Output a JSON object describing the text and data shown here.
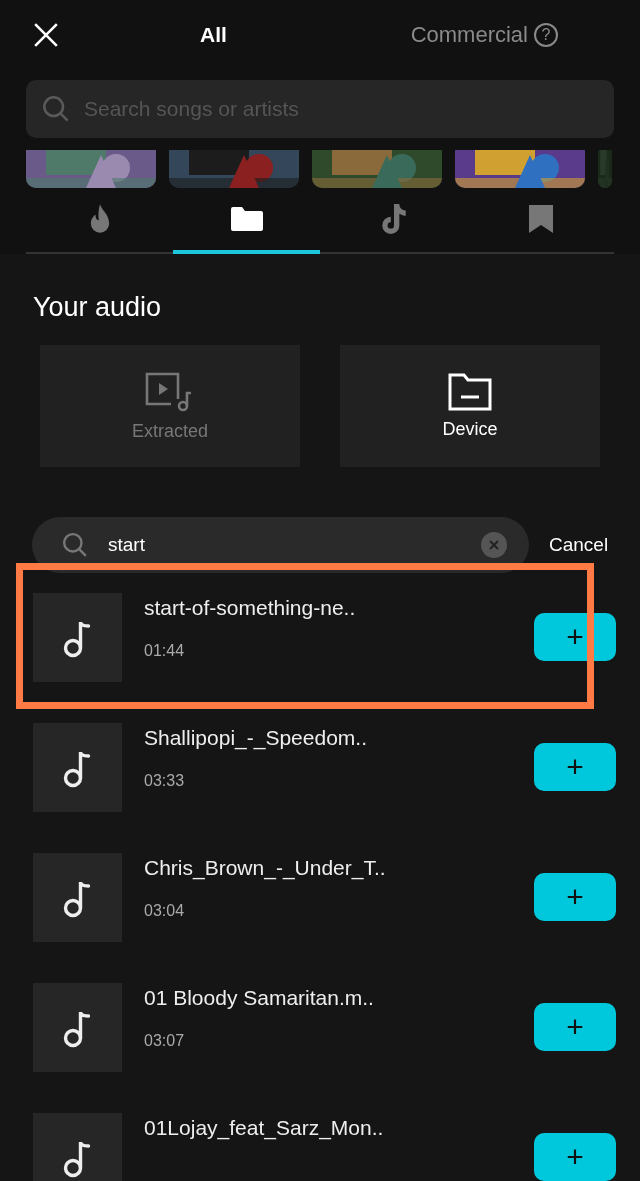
{
  "header": {
    "title": "All",
    "commercial": "Commercial",
    "help_icon_text": "?"
  },
  "search": {
    "placeholder": "Search songs or artists"
  },
  "tabs": [
    {
      "selected": false
    },
    {
      "selected": true
    },
    {
      "selected": false
    },
    {
      "selected": false
    }
  ],
  "section_title": "Your audio",
  "sources": [
    {
      "label": "Extracted",
      "disabled": true
    },
    {
      "label": "Device",
      "disabled": false
    }
  ],
  "filter": {
    "value": "start",
    "cancel": "Cancel"
  },
  "tracks": [
    {
      "title": "start-of-something-ne..",
      "duration": "01:44",
      "highlighted": true,
      "add": "+"
    },
    {
      "title": "Shallipopi_-_Speedom..",
      "duration": "03:33",
      "highlighted": false,
      "add": "+"
    },
    {
      "title": "Chris_Brown_-_Under_T..",
      "duration": "03:04",
      "highlighted": false,
      "add": "+"
    },
    {
      "title": "01 Bloody Samaritan.m..",
      "duration": "03:07",
      "highlighted": false,
      "add": "+"
    },
    {
      "title": "01Lojay_feat_Sarz_Mon..",
      "highlighted": false,
      "add": "+"
    }
  ]
}
